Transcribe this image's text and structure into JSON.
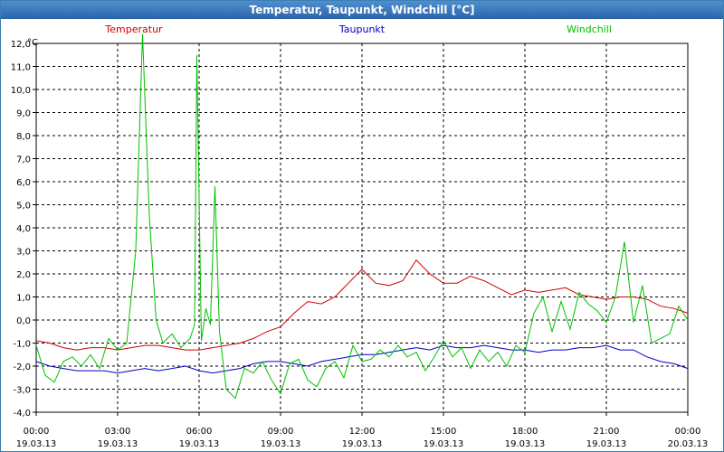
{
  "window": {
    "title": "Temperatur, Taupunkt, Windchill [°C]"
  },
  "colors": {
    "temperatur": "#d00000",
    "taupunkt": "#0000c8",
    "windchill": "#00c000",
    "grid": "#000000",
    "title_bar": "#2f6fb5"
  },
  "chart_data": {
    "type": "line",
    "title": "Temperatur, Taupunkt, Windchill [°C]",
    "ylabel": "°C",
    "ylim": [
      -4.0,
      12.0
    ],
    "yticks": [
      "-4,0",
      "-3,0",
      "-2,0",
      "-1,0",
      "0,0",
      "1,0",
      "2,0",
      "3,0",
      "4,0",
      "5,0",
      "6,0",
      "7,0",
      "8,0",
      "9,0",
      "10,0",
      "11,0",
      "12,0"
    ],
    "xlim": [
      "19.03.13 00:00",
      "20.03.13 00:00"
    ],
    "xticks": [
      {
        "time": "00:00",
        "date": "19.03.13"
      },
      {
        "time": "03:00",
        "date": "19.03.13"
      },
      {
        "time": "06:00",
        "date": "19.03.13"
      },
      {
        "time": "09:00",
        "date": "19.03.13"
      },
      {
        "time": "12:00",
        "date": "19.03.13"
      },
      {
        "time": "15:00",
        "date": "19.03.13"
      },
      {
        "time": "18:00",
        "date": "19.03.13"
      },
      {
        "time": "21:00",
        "date": "19.03.13"
      },
      {
        "time": "00:00",
        "date": "20.03.13"
      }
    ],
    "grid": true,
    "legend": [
      "Temperatur",
      "Taupunkt",
      "Windchill"
    ],
    "series": [
      {
        "name": "Temperatur",
        "x": [
          "19.03.13 00:00",
          "19.03.13 00:30",
          "19.03.13 01:00",
          "19.03.13 01:30",
          "19.03.13 02:00",
          "19.03.13 02:30",
          "19.03.13 03:00",
          "19.03.13 03:30",
          "19.03.13 04:00",
          "19.03.13 04:30",
          "19.03.13 05:00",
          "19.03.13 05:30",
          "19.03.13 06:00",
          "19.03.13 06:30",
          "19.03.13 07:00",
          "19.03.13 07:30",
          "19.03.13 08:00",
          "19.03.13 08:30",
          "19.03.13 09:00",
          "19.03.13 09:30",
          "19.03.13 10:00",
          "19.03.13 10:30",
          "19.03.13 11:00",
          "19.03.13 11:30",
          "19.03.13 12:00",
          "19.03.13 12:30",
          "19.03.13 13:00",
          "19.03.13 13:30",
          "19.03.13 14:00",
          "19.03.13 14:30",
          "19.03.13 15:00",
          "19.03.13 15:30",
          "19.03.13 16:00",
          "19.03.13 16:30",
          "19.03.13 17:00",
          "19.03.13 17:30",
          "19.03.13 18:00",
          "19.03.13 18:30",
          "19.03.13 19:00",
          "19.03.13 19:30",
          "19.03.13 20:00",
          "19.03.13 20:30",
          "19.03.13 21:00",
          "19.03.13 21:30",
          "19.03.13 22:00",
          "19.03.13 22:30",
          "19.03.13 23:00",
          "19.03.13 23:30",
          "20.03.13 00:00"
        ],
        "y": [
          -0.9,
          -1.0,
          -1.2,
          -1.3,
          -1.2,
          -1.2,
          -1.3,
          -1.2,
          -1.1,
          -1.1,
          -1.2,
          -1.3,
          -1.3,
          -1.2,
          -1.1,
          -1.0,
          -0.8,
          -0.5,
          -0.3,
          0.3,
          0.8,
          0.7,
          1.0,
          1.6,
          2.2,
          1.6,
          1.5,
          1.7,
          2.6,
          2.0,
          1.6,
          1.6,
          1.9,
          1.7,
          1.4,
          1.1,
          1.3,
          1.2,
          1.3,
          1.4,
          1.1,
          1.0,
          0.9,
          1.0,
          1.0,
          0.9,
          0.6,
          0.5,
          0.3
        ]
      },
      {
        "name": "Taupunkt",
        "x": [
          "19.03.13 00:00",
          "19.03.13 00:30",
          "19.03.13 01:00",
          "19.03.13 01:30",
          "19.03.13 02:00",
          "19.03.13 02:30",
          "19.03.13 03:00",
          "19.03.13 03:30",
          "19.03.13 04:00",
          "19.03.13 04:30",
          "19.03.13 05:00",
          "19.03.13 05:30",
          "19.03.13 06:00",
          "19.03.13 06:30",
          "19.03.13 07:00",
          "19.03.13 07:30",
          "19.03.13 08:00",
          "19.03.13 08:30",
          "19.03.13 09:00",
          "19.03.13 09:30",
          "19.03.13 10:00",
          "19.03.13 10:30",
          "19.03.13 11:00",
          "19.03.13 11:30",
          "19.03.13 12:00",
          "19.03.13 12:30",
          "19.03.13 13:00",
          "19.03.13 13:30",
          "19.03.13 14:00",
          "19.03.13 14:30",
          "19.03.13 15:00",
          "19.03.13 15:30",
          "19.03.13 16:00",
          "19.03.13 16:30",
          "19.03.13 17:00",
          "19.03.13 17:30",
          "19.03.13 18:00",
          "19.03.13 18:30",
          "19.03.13 19:00",
          "19.03.13 19:30",
          "19.03.13 20:00",
          "19.03.13 20:30",
          "19.03.13 21:00",
          "19.03.13 21:30",
          "19.03.13 22:00",
          "19.03.13 22:30",
          "19.03.13 23:00",
          "19.03.13 23:30",
          "20.03.13 00:00"
        ],
        "y": [
          -1.8,
          -2.0,
          -2.1,
          -2.2,
          -2.2,
          -2.2,
          -2.3,
          -2.2,
          -2.1,
          -2.2,
          -2.1,
          -2.0,
          -2.2,
          -2.3,
          -2.2,
          -2.1,
          -1.9,
          -1.8,
          -1.8,
          -1.9,
          -2.0,
          -1.8,
          -1.7,
          -1.6,
          -1.5,
          -1.5,
          -1.4,
          -1.3,
          -1.2,
          -1.3,
          -1.1,
          -1.2,
          -1.2,
          -1.1,
          -1.2,
          -1.3,
          -1.3,
          -1.4,
          -1.3,
          -1.3,
          -1.2,
          -1.2,
          -1.1,
          -1.3,
          -1.3,
          -1.6,
          -1.8,
          -1.9,
          -2.1
        ]
      },
      {
        "name": "Windchill",
        "x": [
          "19.03.13 00:00",
          "19.03.13 00:20",
          "19.03.13 00:40",
          "19.03.13 01:00",
          "19.03.13 01:20",
          "19.03.13 01:40",
          "19.03.13 02:00",
          "19.03.13 02:20",
          "19.03.13 02:40",
          "19.03.13 03:00",
          "19.03.13 03:20",
          "19.03.13 03:40",
          "19.03.13 03:55",
          "19.03.13 04:10",
          "19.03.13 04:25",
          "19.03.13 04:40",
          "19.03.13 05:00",
          "19.03.13 05:20",
          "19.03.13 05:40",
          "19.03.13 05:50",
          "19.03.13 05:55",
          "19.03.13 06:05",
          "19.03.13 06:15",
          "19.03.13 06:25",
          "19.03.13 06:35",
          "19.03.13 06:45",
          "19.03.13 07:00",
          "19.03.13 07:20",
          "19.03.13 07:40",
          "19.03.13 08:00",
          "19.03.13 08:20",
          "19.03.13 08:40",
          "19.03.13 09:00",
          "19.03.13 09:20",
          "19.03.13 09:40",
          "19.03.13 10:00",
          "19.03.13 10:20",
          "19.03.13 10:40",
          "19.03.13 11:00",
          "19.03.13 11:20",
          "19.03.13 11:40",
          "19.03.13 12:00",
          "19.03.13 12:20",
          "19.03.13 12:40",
          "19.03.13 13:00",
          "19.03.13 13:20",
          "19.03.13 13:40",
          "19.03.13 14:00",
          "19.03.13 14:20",
          "19.03.13 14:40",
          "19.03.13 15:00",
          "19.03.13 15:20",
          "19.03.13 15:40",
          "19.03.13 16:00",
          "19.03.13 16:20",
          "19.03.13 16:40",
          "19.03.13 17:00",
          "19.03.13 17:20",
          "19.03.13 17:40",
          "19.03.13 18:00",
          "19.03.13 18:20",
          "19.03.13 18:40",
          "19.03.13 19:00",
          "19.03.13 19:20",
          "19.03.13 19:40",
          "19.03.13 20:00",
          "19.03.13 20:20",
          "19.03.13 20:40",
          "19.03.13 21:00",
          "19.03.13 21:20",
          "19.03.13 21:40",
          "19.03.13 22:00",
          "19.03.13 22:20",
          "19.03.13 22:40",
          "19.03.13 23:00",
          "19.03.13 23:20",
          "19.03.13 23:40",
          "20.03.13 00:00"
        ],
        "y": [
          -1.1,
          -2.4,
          -2.7,
          -1.8,
          -1.6,
          -2.0,
          -1.5,
          -2.1,
          -0.8,
          -1.3,
          -1.0,
          3.0,
          12.4,
          4.5,
          0.0,
          -1.0,
          -0.6,
          -1.2,
          -0.8,
          -0.2,
          11.5,
          -0.9,
          0.5,
          -0.2,
          5.8,
          -0.5,
          -3.0,
          -3.4,
          -2.1,
          -2.3,
          -1.8,
          -2.6,
          -3.2,
          -1.9,
          -1.7,
          -2.6,
          -2.9,
          -2.1,
          -1.8,
          -2.5,
          -1.1,
          -1.8,
          -1.7,
          -1.3,
          -1.6,
          -1.1,
          -1.6,
          -1.4,
          -2.2,
          -1.6,
          -0.9,
          -1.6,
          -1.2,
          -2.1,
          -1.3,
          -1.8,
          -1.4,
          -2.0,
          -1.1,
          -1.4,
          0.3,
          1.0,
          -0.5,
          0.8,
          -0.4,
          1.2,
          0.7,
          0.4,
          -0.1,
          1.0,
          3.4,
          -0.1,
          1.5,
          -1.0,
          -0.8,
          -0.6,
          0.6,
          0.0
        ]
      }
    ]
  }
}
